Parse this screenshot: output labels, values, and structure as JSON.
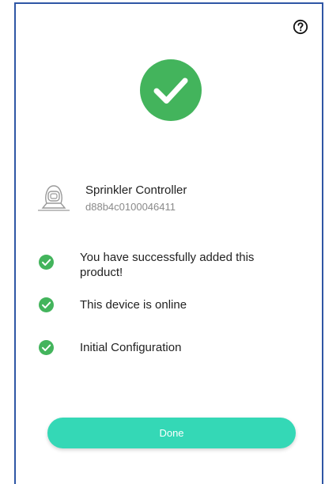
{
  "icons": {
    "help": "help-circle-icon",
    "success": "checkmark-circle-icon",
    "device": "sprinkler-controller-icon",
    "status_check": "check-circle-icon"
  },
  "colors": {
    "success_green": "#43b45c",
    "button_teal": "#34d8b6",
    "frame_border": "#2f56a5",
    "secondary_text": "#8a8a8a"
  },
  "device": {
    "name": "Sprinkler Controller",
    "id": "d88b4c0100046411"
  },
  "status_items": [
    {
      "label": "You have successfully added this product!"
    },
    {
      "label": "This device is online"
    },
    {
      "label": "Initial Configuration"
    }
  ],
  "actions": {
    "done_label": "Done"
  }
}
